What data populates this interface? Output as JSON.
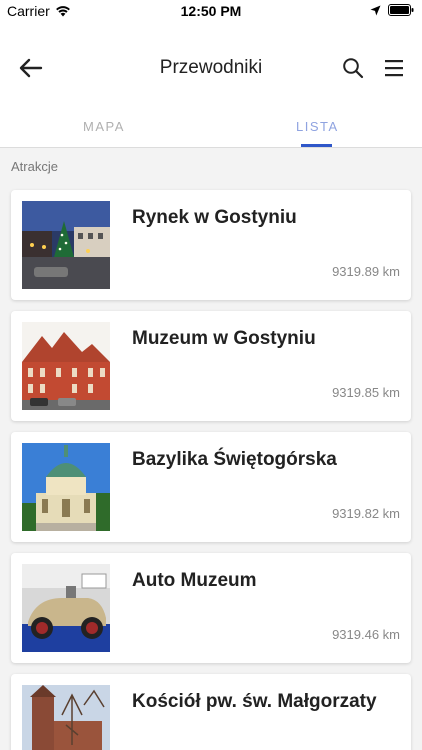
{
  "status": {
    "carrier": "Carrier",
    "time": "12:50 PM"
  },
  "navbar": {
    "title": "Przewodniki"
  },
  "tabs": [
    {
      "label": "MAPA",
      "active": false
    },
    {
      "label": "LISTA",
      "active": true
    }
  ],
  "section_label": "Atrakcje",
  "colors": {
    "accent": "#2f57c9",
    "active_tab_text": "#8fa3e0",
    "inactive_tab_text": "#b0b0b0"
  },
  "items": [
    {
      "title": "Rynek w Gostyniu",
      "distance": "9319.89 km"
    },
    {
      "title": "Muzeum w Gostyniu",
      "distance": "9319.85 km"
    },
    {
      "title": "Bazylika Świętogórska",
      "distance": "9319.82 km"
    },
    {
      "title": "Auto Muzeum",
      "distance": "9319.46 km"
    },
    {
      "title": "Kościół pw. św. Małgorzaty",
      "distance": ""
    }
  ]
}
